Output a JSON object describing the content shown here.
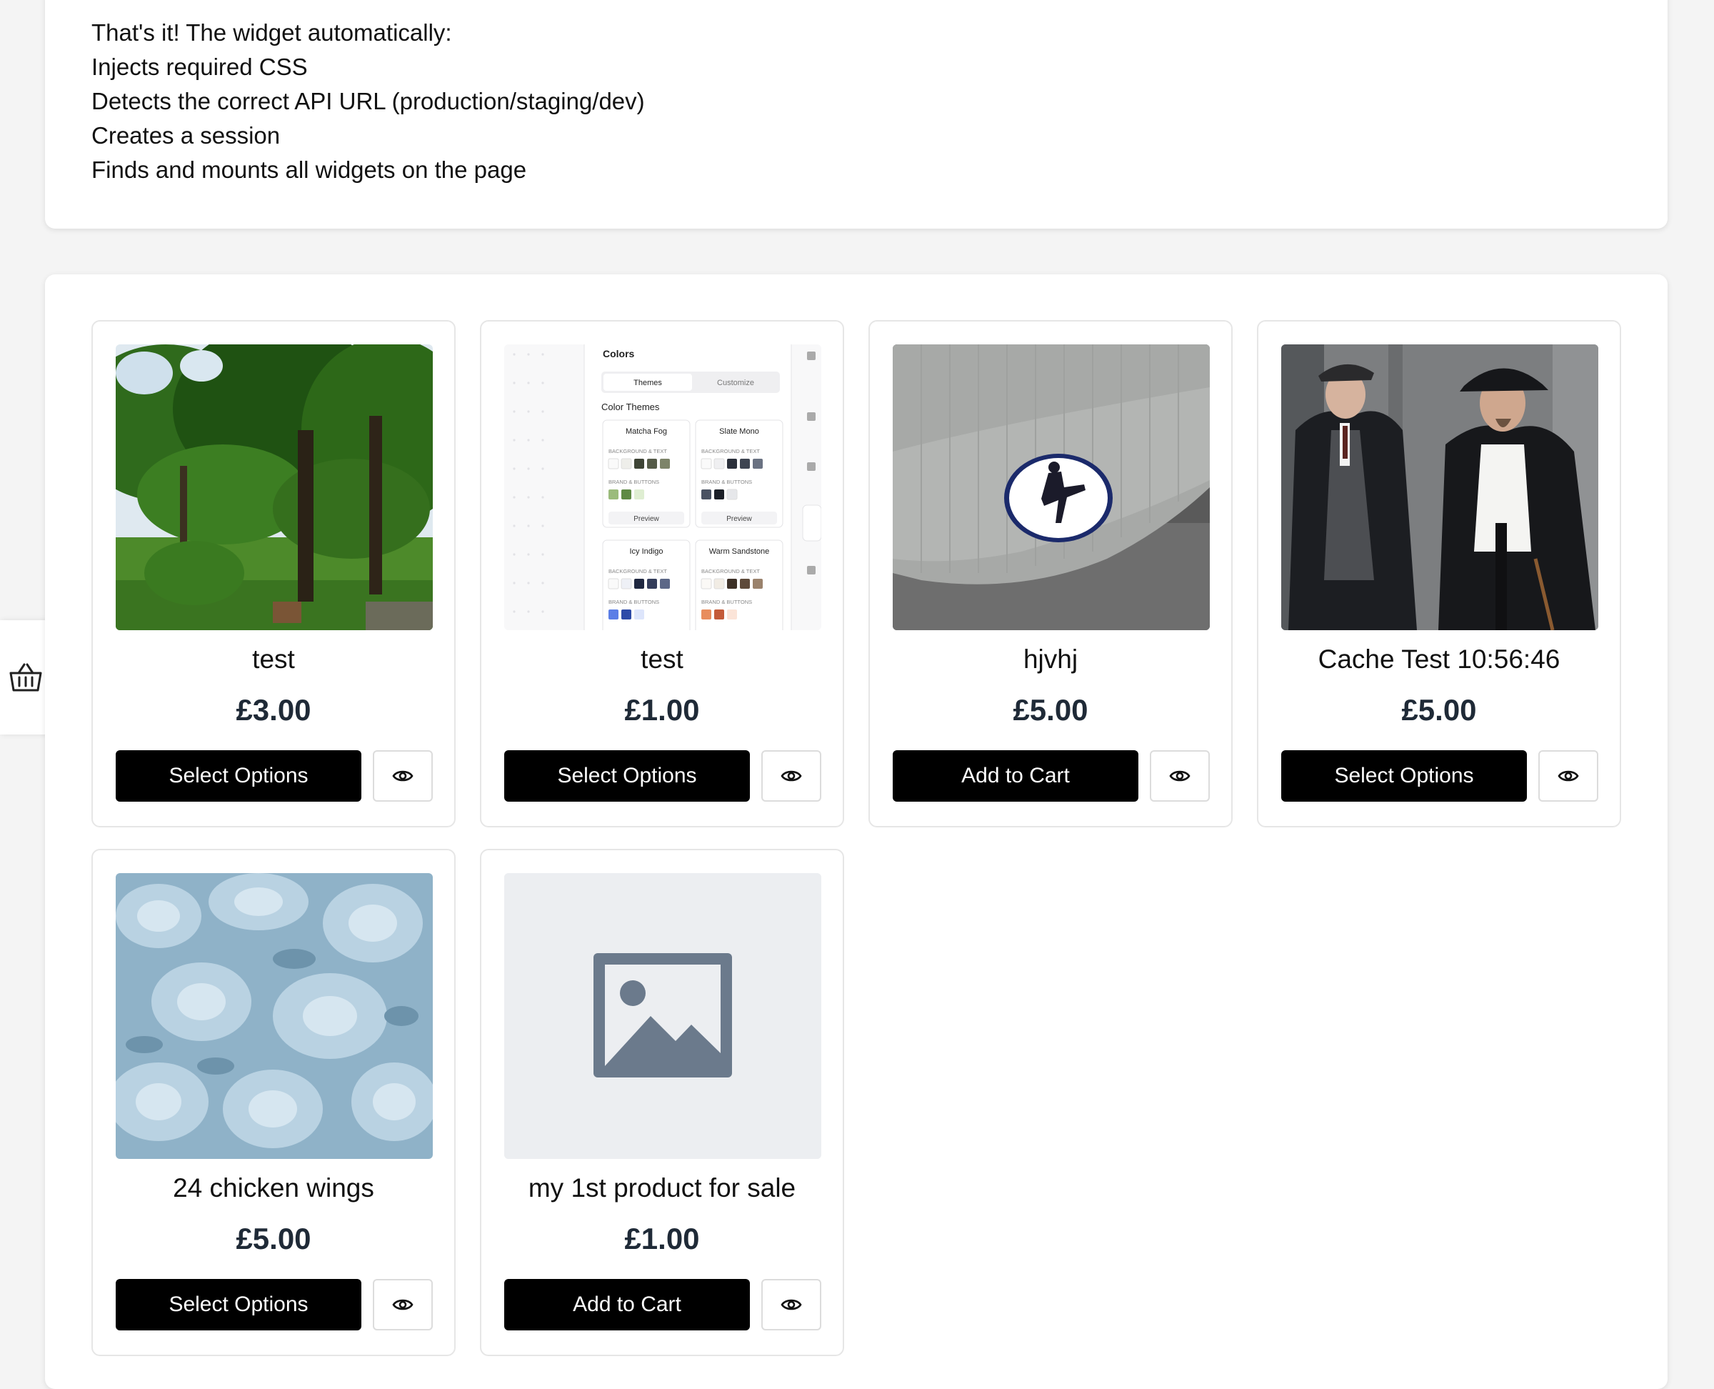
{
  "intro": {
    "lines": [
      "That's it! The widget automatically:",
      "Injects required CSS",
      "Detects the correct API URL (production/staging/dev)",
      "Creates a session",
      "Finds and mounts all widgets on the page"
    ]
  },
  "cart_tab": {
    "icon": "basket-icon"
  },
  "products": [
    {
      "name": "test",
      "price": "£3.00",
      "button": "Select Options",
      "image": "park-trees-photo"
    },
    {
      "name": "test",
      "price": "£1.00",
      "button": "Select Options",
      "image": "color-themes-screenshot",
      "screenshot_text": {
        "heading": "Colors",
        "tab_themes": "Themes",
        "tab_customize": "Customize",
        "section": "Color Themes",
        "themes": [
          "Matcha Fog",
          "Slate Mono",
          "Icy Indigo",
          "Warm Sandstone"
        ],
        "bg_label": "BACKGROUND & TEXT",
        "brand_label": "BRAND & BUTTONS",
        "preview": "Preview"
      }
    },
    {
      "name": "hjvhj",
      "price": "£5.00",
      "button": "Add to Cart",
      "image": "grey-beanie-photo"
    },
    {
      "name": "Cache Test 10:56:46",
      "price": "£5.00",
      "button": "Select Options",
      "image": "two-men-coats-photo"
    },
    {
      "name": "24 chicken wings",
      "price": "£5.00",
      "button": "Select Options",
      "image": "succulents-photo"
    },
    {
      "name": "my 1st product for sale",
      "price": "£1.00",
      "button": "Add to Cart",
      "image": "image-placeholder-icon"
    }
  ],
  "quick_view_icon": "eye-icon",
  "colors": {
    "button_bg": "#000000",
    "price_text": "#1f2a37",
    "page_bg": "#f4f4f4",
    "placeholder_icon": "#6b7a8c"
  }
}
